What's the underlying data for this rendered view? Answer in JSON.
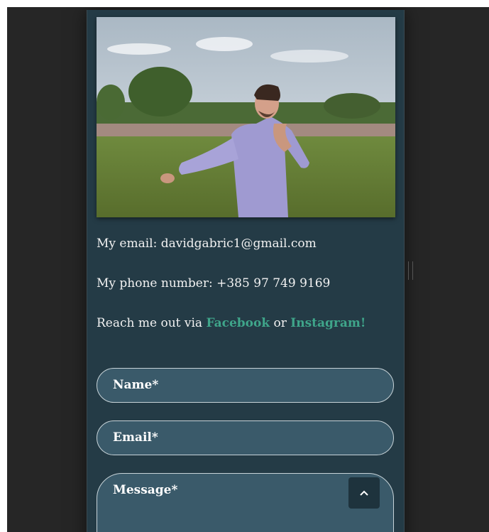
{
  "contact": {
    "email_line": "My email: davidgabric1@gmail.com",
    "phone_line": "My phone number: +385 97 749 9169",
    "reach_prefix": "Reach me out via ",
    "facebook_link": "Facebook",
    "reach_or": " or ",
    "instagram_link": "Instagram!"
  },
  "form": {
    "name_placeholder": "Name*",
    "email_placeholder": "Email*",
    "message_placeholder": "Message*"
  },
  "icons": {
    "scroll_top": "chevron-up-icon",
    "resize_handle": "drag-handle-icon"
  },
  "colors": {
    "card_background": "#243b46",
    "page_background": "#262626",
    "link": "#3fa58a",
    "field_background": "#3a5a6a"
  }
}
